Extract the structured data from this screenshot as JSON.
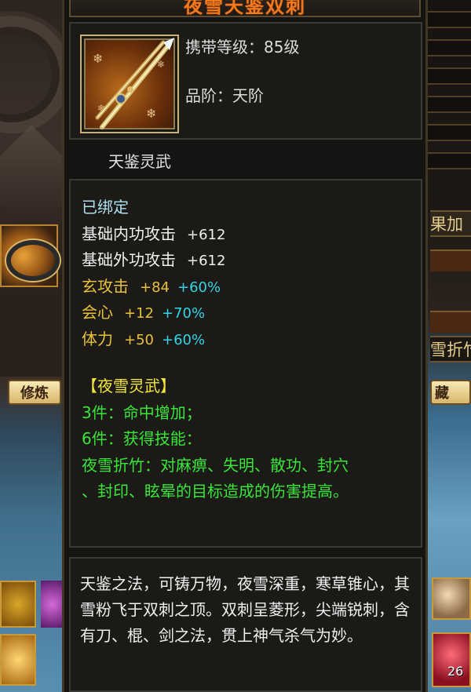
{
  "tooltip": {
    "title": "夜雪天鉴双刺",
    "required_level": "携带等级：85级",
    "grade": "品阶：天阶",
    "set_tag": "天鉴灵武",
    "bound": "已绑定",
    "stats": [
      {
        "name": "基础内功攻击",
        "value": "+612",
        "bonus": ""
      },
      {
        "name": "基础外功攻击",
        "value": "+612",
        "bonus": ""
      },
      {
        "name": "玄攻击",
        "value": "+84",
        "bonus": "+60%"
      },
      {
        "name": "会心",
        "value": "+12",
        "bonus": "+70%"
      },
      {
        "name": "体力",
        "value": "+50",
        "bonus": "+60%"
      }
    ],
    "set_bonus": {
      "name": "【夜雪灵武】",
      "piece3": "3件：命中增加；",
      "piece6": "6件：获得技能：",
      "skill_line1": "夜雪折竹：对麻痹、失明、散功、封穴",
      "skill_line2": "、封印、眩晕的目标造成的伤害提高。"
    },
    "description": "天鉴之法，可铸万物，夜雪深重，寒草锥心，其雪粉飞于双刺之顶。双刺呈菱形，尖端锐刺，含有刀、棍、剑之法，贯上神气杀气为妙。"
  },
  "background": {
    "left_tab": "修炼",
    "right_tab": "藏",
    "right_label_1": "果加",
    "right_label_2": "雪折竹",
    "stack_count": "26"
  },
  "colors": {
    "title": "#f07a1f",
    "stat_name_attr": "#e8c23a",
    "bonus_pct": "#33d5e6",
    "set_text": "#39e639",
    "set_name": "#f2e83a"
  }
}
